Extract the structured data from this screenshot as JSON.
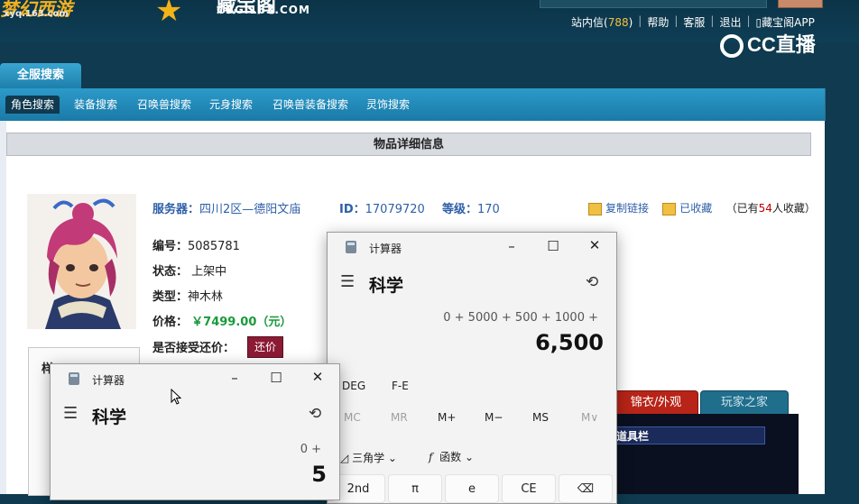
{
  "header": {
    "logo_left_text": "xyq.163.com",
    "logo_center_domain": "CBG.163.COM",
    "links": [
      {
        "label": "站内信",
        "count": "788"
      },
      {
        "label": "帮助"
      },
      {
        "label": "客服"
      },
      {
        "label": "退出"
      },
      {
        "label": "藏宝阁APP"
      }
    ],
    "watermark": "CC直播"
  },
  "search": {
    "panel_tab": "全服搜索",
    "tabs": [
      "角色搜索",
      "装备搜索",
      "召唤兽搜索",
      "元身搜索",
      "召唤兽装备搜索",
      "灵饰搜索"
    ]
  },
  "detail": {
    "title": "物品详细信息",
    "server_label": "服务器：",
    "server": "四川2区—德阳文庙",
    "id_label": "ID：",
    "id": "17079720",
    "level_label": "等级：",
    "level": "170",
    "copy_link": "复制链接",
    "favorited": "已收藏",
    "fav_prefix": "（已有",
    "fav_count": "54",
    "fav_suffix": "人收藏）",
    "serial_label": "编号：",
    "serial": "5085781",
    "status_label": "状态：",
    "status": "上架中",
    "type_label": "类型：",
    "type": "神木林",
    "price_label": "价格：",
    "price": "￥7499.00（元）",
    "bargain_label": "是否接受还价：",
    "bargain_button": "还价",
    "left_box_tab": "样"
  },
  "right_tabs": [
    "锦衣/外观",
    "玩家之家"
  ],
  "toolbar_label": "道具栏",
  "calc_back": {
    "title": "计算器",
    "mode": "科学",
    "expression": "0 + 5000 + 500 + 1000 +",
    "result": "6,500",
    "angle": "DEG",
    "fe": "F-E",
    "memory": [
      "MC",
      "MR",
      "M+",
      "M−",
      "MS",
      "M∨"
    ],
    "trig": "三角学",
    "func": "函数",
    "keys": [
      "2nd",
      "π",
      "e",
      "CE",
      "⌫"
    ]
  },
  "calc_front": {
    "title": "计算器",
    "mode": "科学",
    "expression": "0 +",
    "result": "5"
  },
  "colors": {
    "accent_blue": "#2c9acb",
    "price_green": "#1a9a3a",
    "bargain_red": "#8c1a34"
  }
}
